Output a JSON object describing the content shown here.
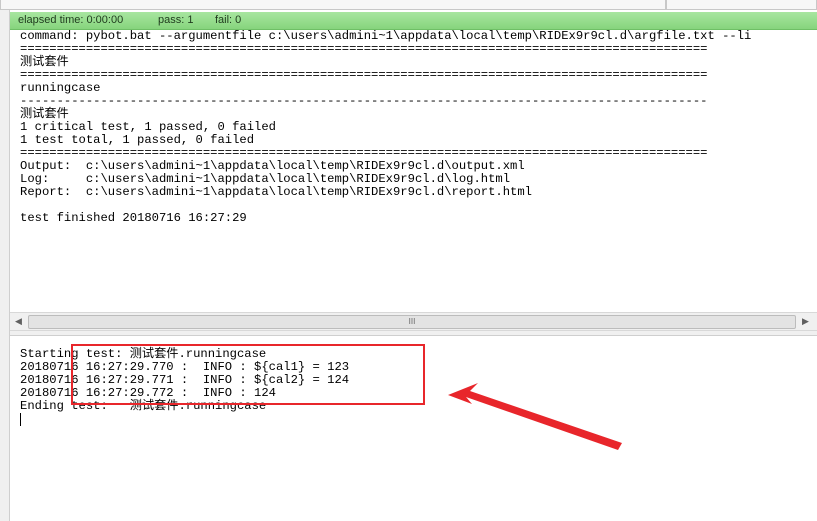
{
  "status": {
    "elapsed_label": "elapsed time: 0:00:00",
    "pass_label": "pass: 1",
    "fail_label": "fail: 0"
  },
  "console": {
    "lines": [
      "command: pybot.bat --argumentfile c:\\users\\admini~1\\appdata\\local\\temp\\RIDEx9r9cl.d\\argfile.txt --li",
      "==============================================================================================",
      "测试套件",
      "==============================================================================================",
      "runningcase",
      "----------------------------------------------------------------------------------------------",
      "测试套件",
      "1 critical test, 1 passed, 0 failed",
      "1 test total, 1 passed, 0 failed",
      "==============================================================================================",
      "Output:  c:\\users\\admini~1\\appdata\\local\\temp\\RIDEx9r9cl.d\\output.xml",
      "Log:     c:\\users\\admini~1\\appdata\\local\\temp\\RIDEx9r9cl.d\\log.html",
      "Report:  c:\\users\\admini~1\\appdata\\local\\temp\\RIDEx9r9cl.d\\report.html",
      "",
      "test finished 20180716 16:27:29"
    ]
  },
  "scrollbar": {
    "left_arrow": "◀",
    "right_arrow": "▶",
    "grip": "III"
  },
  "log": {
    "lines": [
      "Starting test: 测试套件.runningcase",
      "20180716 16:27:29.770 :  INFO : ${cal1} = 123",
      "20180716 16:27:29.771 :  INFO : ${cal2} = 124",
      "20180716 16:27:29.772 :  INFO : 124",
      "Ending test:   测试套件.runningcase"
    ]
  },
  "colors": {
    "status_bar": "#8fd987",
    "highlight": "#e8262b"
  }
}
